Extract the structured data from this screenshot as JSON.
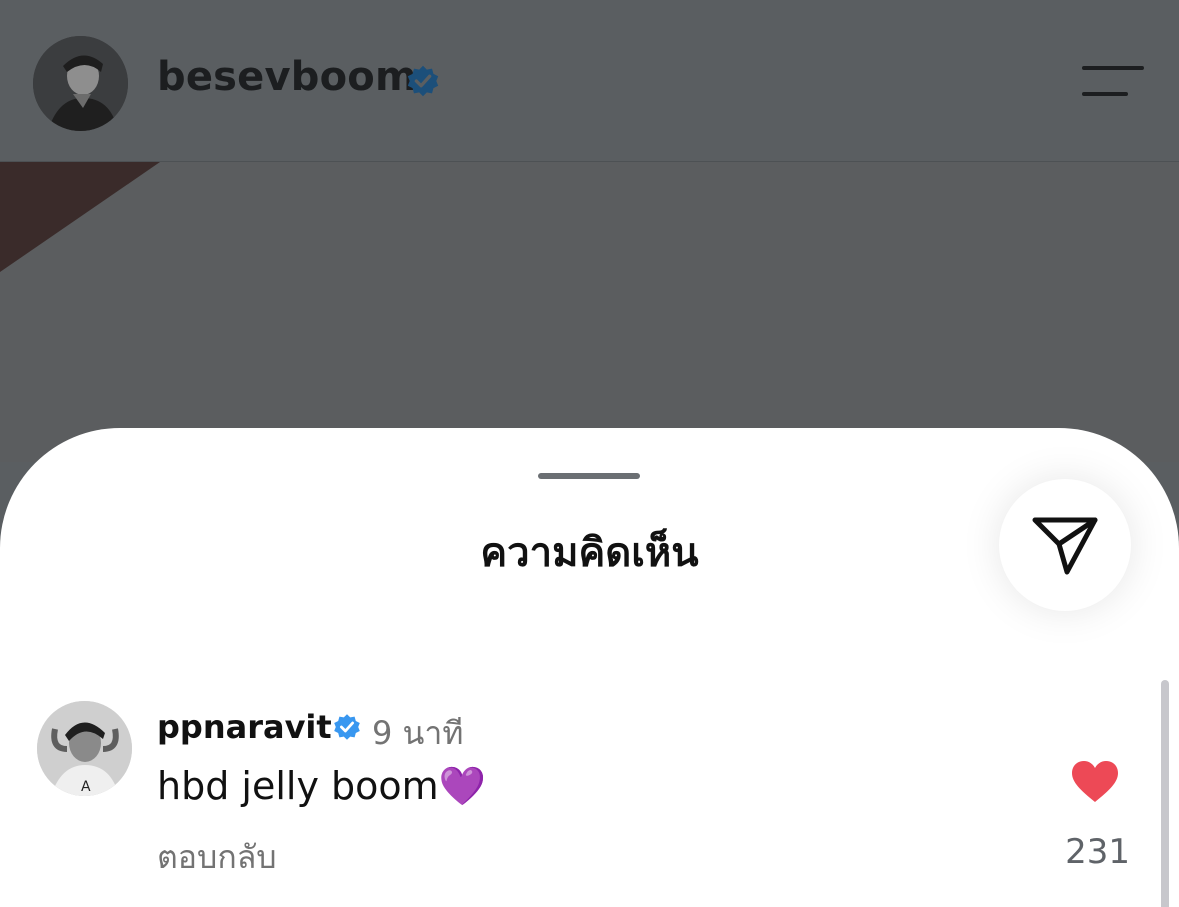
{
  "header": {
    "username": "besevboom",
    "verified": true
  },
  "sheet": {
    "title": "ความคิดเห็น"
  },
  "comments": [
    {
      "username": "ppnaravit",
      "verified": true,
      "time": "9 นาที",
      "text": "hbd jelly boom💜",
      "reply_label": "ตอบกลับ",
      "likes": "231",
      "liked": true
    }
  ],
  "colors": {
    "verified_badge": "#3897f0",
    "like_heart": "#ed4956",
    "muted_text": "#737373",
    "overlay_dim": "#5a5e61"
  },
  "icons": {
    "menu": "hamburger-icon",
    "share": "send-icon",
    "verified": "verified-badge-icon",
    "like": "heart-icon"
  }
}
